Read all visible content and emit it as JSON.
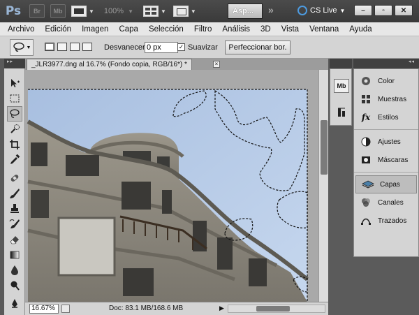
{
  "app": {
    "logo_text": "Ps",
    "bridge_label": "Br",
    "minibridge_label": "Mb",
    "zoom_level": "100%",
    "workspace_label": "Asp...",
    "more_label": "»",
    "cs_live_label": "CS Live",
    "window_controls": {
      "minimize": "–",
      "restore": "▫",
      "close": "✕"
    }
  },
  "menu": {
    "items": [
      "Archivo",
      "Edición",
      "Imagen",
      "Capa",
      "Selección",
      "Filtro",
      "Análisis",
      "3D",
      "Vista",
      "Ventana",
      "Ayuda"
    ]
  },
  "options": {
    "feather_label": "Desvanecer:",
    "feather_value": "0 px",
    "smooth_label": "Suavizar",
    "smooth_checked": "✓",
    "refine_label": "Perfeccionar bor."
  },
  "document": {
    "tab_title": "_JLR3977.dng al 16.7% (Fondo copia, RGB/16*) *",
    "close_glyph": "×"
  },
  "status": {
    "zoom": "16.67%",
    "doc_info": "Doc: 83.1 MB/168.6 MB",
    "arrow": "▶"
  },
  "panels": {
    "group1": [
      {
        "label": "Color",
        "icon": "color-wheel-icon"
      },
      {
        "label": "Muestras",
        "icon": "swatches-icon"
      },
      {
        "label": "Estilos",
        "icon": "styles-icon"
      }
    ],
    "group2": [
      {
        "label": "Ajustes",
        "icon": "adjustments-icon"
      },
      {
        "label": "Máscaras",
        "icon": "masks-icon"
      }
    ],
    "group3": [
      {
        "label": "Capas",
        "icon": "layers-icon"
      },
      {
        "label": "Canales",
        "icon": "channels-icon"
      },
      {
        "label": "Trazados",
        "icon": "paths-icon"
      }
    ],
    "strip_mb": "Mb"
  },
  "colors": {
    "sky": "#b3c9e6",
    "building": "#8d8a80",
    "accent": "#4d9be0"
  }
}
